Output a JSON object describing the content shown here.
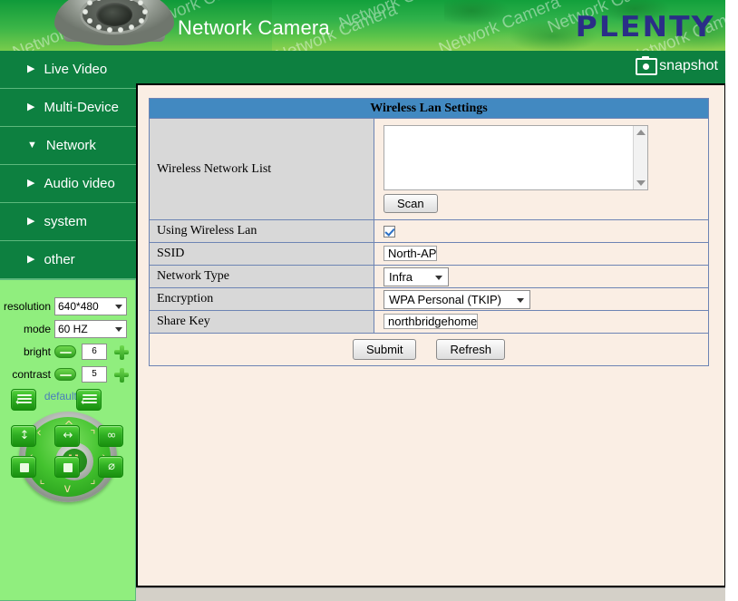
{
  "header": {
    "title": "Network Camera",
    "logo": "PLENTY",
    "watermark_text": "Network Camera",
    "camera_icon": "dome-camera-image"
  },
  "topbar": {
    "snapshot_label": "snapshot",
    "snapshot_icon": "camera-icon"
  },
  "sidebar": {
    "items": [
      {
        "label": "Live Video",
        "arrow": "▶",
        "expanded": false
      },
      {
        "label": "Multi-Device",
        "arrow": "▶",
        "expanded": false
      },
      {
        "label": "Network",
        "arrow": "▼",
        "expanded": true
      },
      {
        "label": "Audio video",
        "arrow": "▶",
        "expanded": false
      },
      {
        "label": "system",
        "arrow": "▶",
        "expanded": false
      },
      {
        "label": "other",
        "arrow": "▶",
        "expanded": false
      }
    ]
  },
  "controls": {
    "resolution_label": "resolution",
    "resolution_value": "640*480",
    "mode_label": "mode",
    "mode_value": "60 HZ",
    "bright_label": "bright",
    "bright_value": "6",
    "contrast_label": "contrast",
    "contrast_value": "5",
    "default_all_label": "default all",
    "minus_icon": "minus-icon",
    "plus_icon": "plus-icon"
  },
  "ptz": {
    "joystick_icon": "joystick-pad",
    "buttons": [
      {
        "name": "preset-set-button",
        "glyph": ""
      },
      {
        "name": "preset-call-button",
        "glyph": ""
      },
      {
        "name": "vertical-patrol-button",
        "glyph": "↕"
      },
      {
        "name": "horizontal-patrol-button",
        "glyph": "↔"
      },
      {
        "name": "infinite-patrol-button",
        "glyph": "∞"
      },
      {
        "name": "stop-vertical-button",
        "glyph": ""
      },
      {
        "name": "stop-horizontal-button",
        "glyph": ""
      },
      {
        "name": "io-toggle-button",
        "glyph": "⌀"
      }
    ]
  },
  "main": {
    "panel_title": "Wireless Lan Settings",
    "rows": [
      {
        "label": "Wireless Network List",
        "type": "listbox",
        "value": "",
        "button": "Scan"
      },
      {
        "label": "Using Wireless Lan",
        "type": "checkbox",
        "checked": true
      },
      {
        "label": "SSID",
        "type": "text",
        "value": "North-AP"
      },
      {
        "label": "Network Type",
        "type": "select",
        "value": "Infra"
      },
      {
        "label": "Encryption",
        "type": "select",
        "value": "WPA Personal (TKIP)"
      },
      {
        "label": "Share Key",
        "type": "text",
        "value": "northbridgehome"
      }
    ],
    "submit_label": "Submit",
    "refresh_label": "Refresh"
  },
  "colors": {
    "header_green": "#2fb14a",
    "nav_green": "#0d8040",
    "panel_green": "#90ee7e",
    "table_header_blue": "#4289c1",
    "label_gray": "#d8d8d8",
    "content_bg": "#faeee4",
    "logo_navy": "#2a2e87",
    "link_blue": "#4a7ebb"
  }
}
